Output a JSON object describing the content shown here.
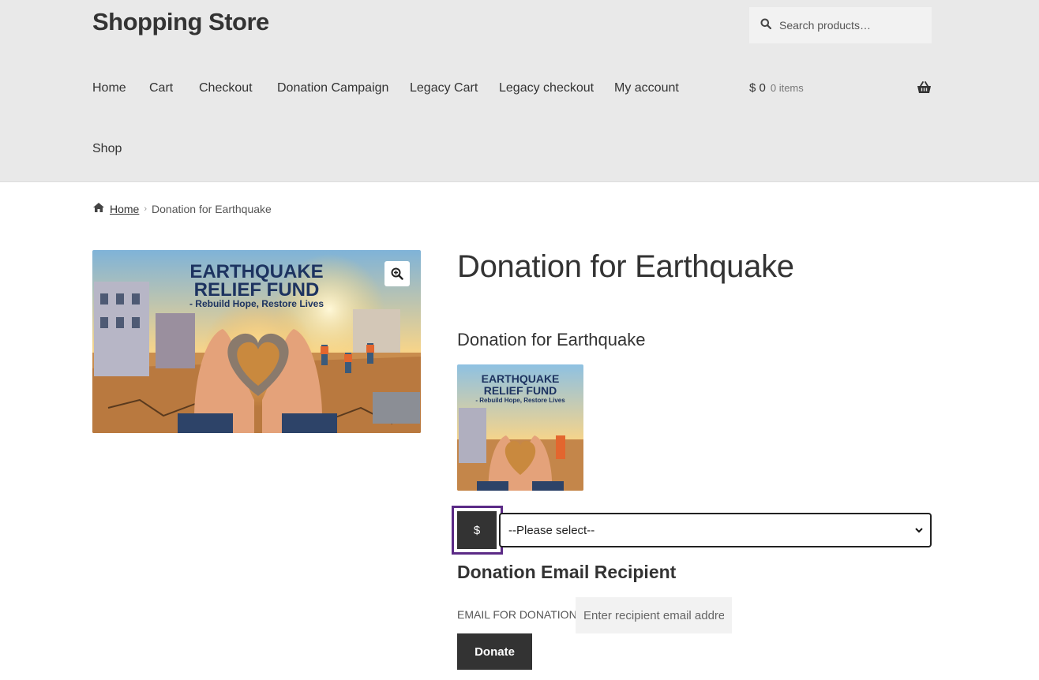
{
  "header": {
    "site_title": "Shopping Store",
    "search_placeholder": "Search products…"
  },
  "nav": {
    "items": [
      "Home",
      "Cart",
      "Checkout",
      "Donation Campaign",
      "Legacy Cart",
      "Legacy checkout",
      "My account",
      "Shop"
    ]
  },
  "cart": {
    "amount": "$ 0",
    "count": "0 items"
  },
  "breadcrumb": {
    "home": "Home",
    "current": "Donation for Earthquake"
  },
  "product": {
    "title": "Donation for Earthquake",
    "subtitle": "Donation for Earthquake",
    "image_text": {
      "line1": "EARTHQUAKE",
      "line2": "RELIEF FUND",
      "line3": "- Rebuild Hope, Restore Lives"
    }
  },
  "donation": {
    "currency_symbol": "$",
    "amount_select": "--Please select--",
    "email_heading": "Donation Email Recipient",
    "email_label": "EMAIL FOR DONATION",
    "email_placeholder": "Enter recipient email address",
    "donate_button": "Donate"
  },
  "colors": {
    "header_bg": "#e9e9e9",
    "button_dark": "#333333",
    "focus_outline": "#5b2a86"
  }
}
